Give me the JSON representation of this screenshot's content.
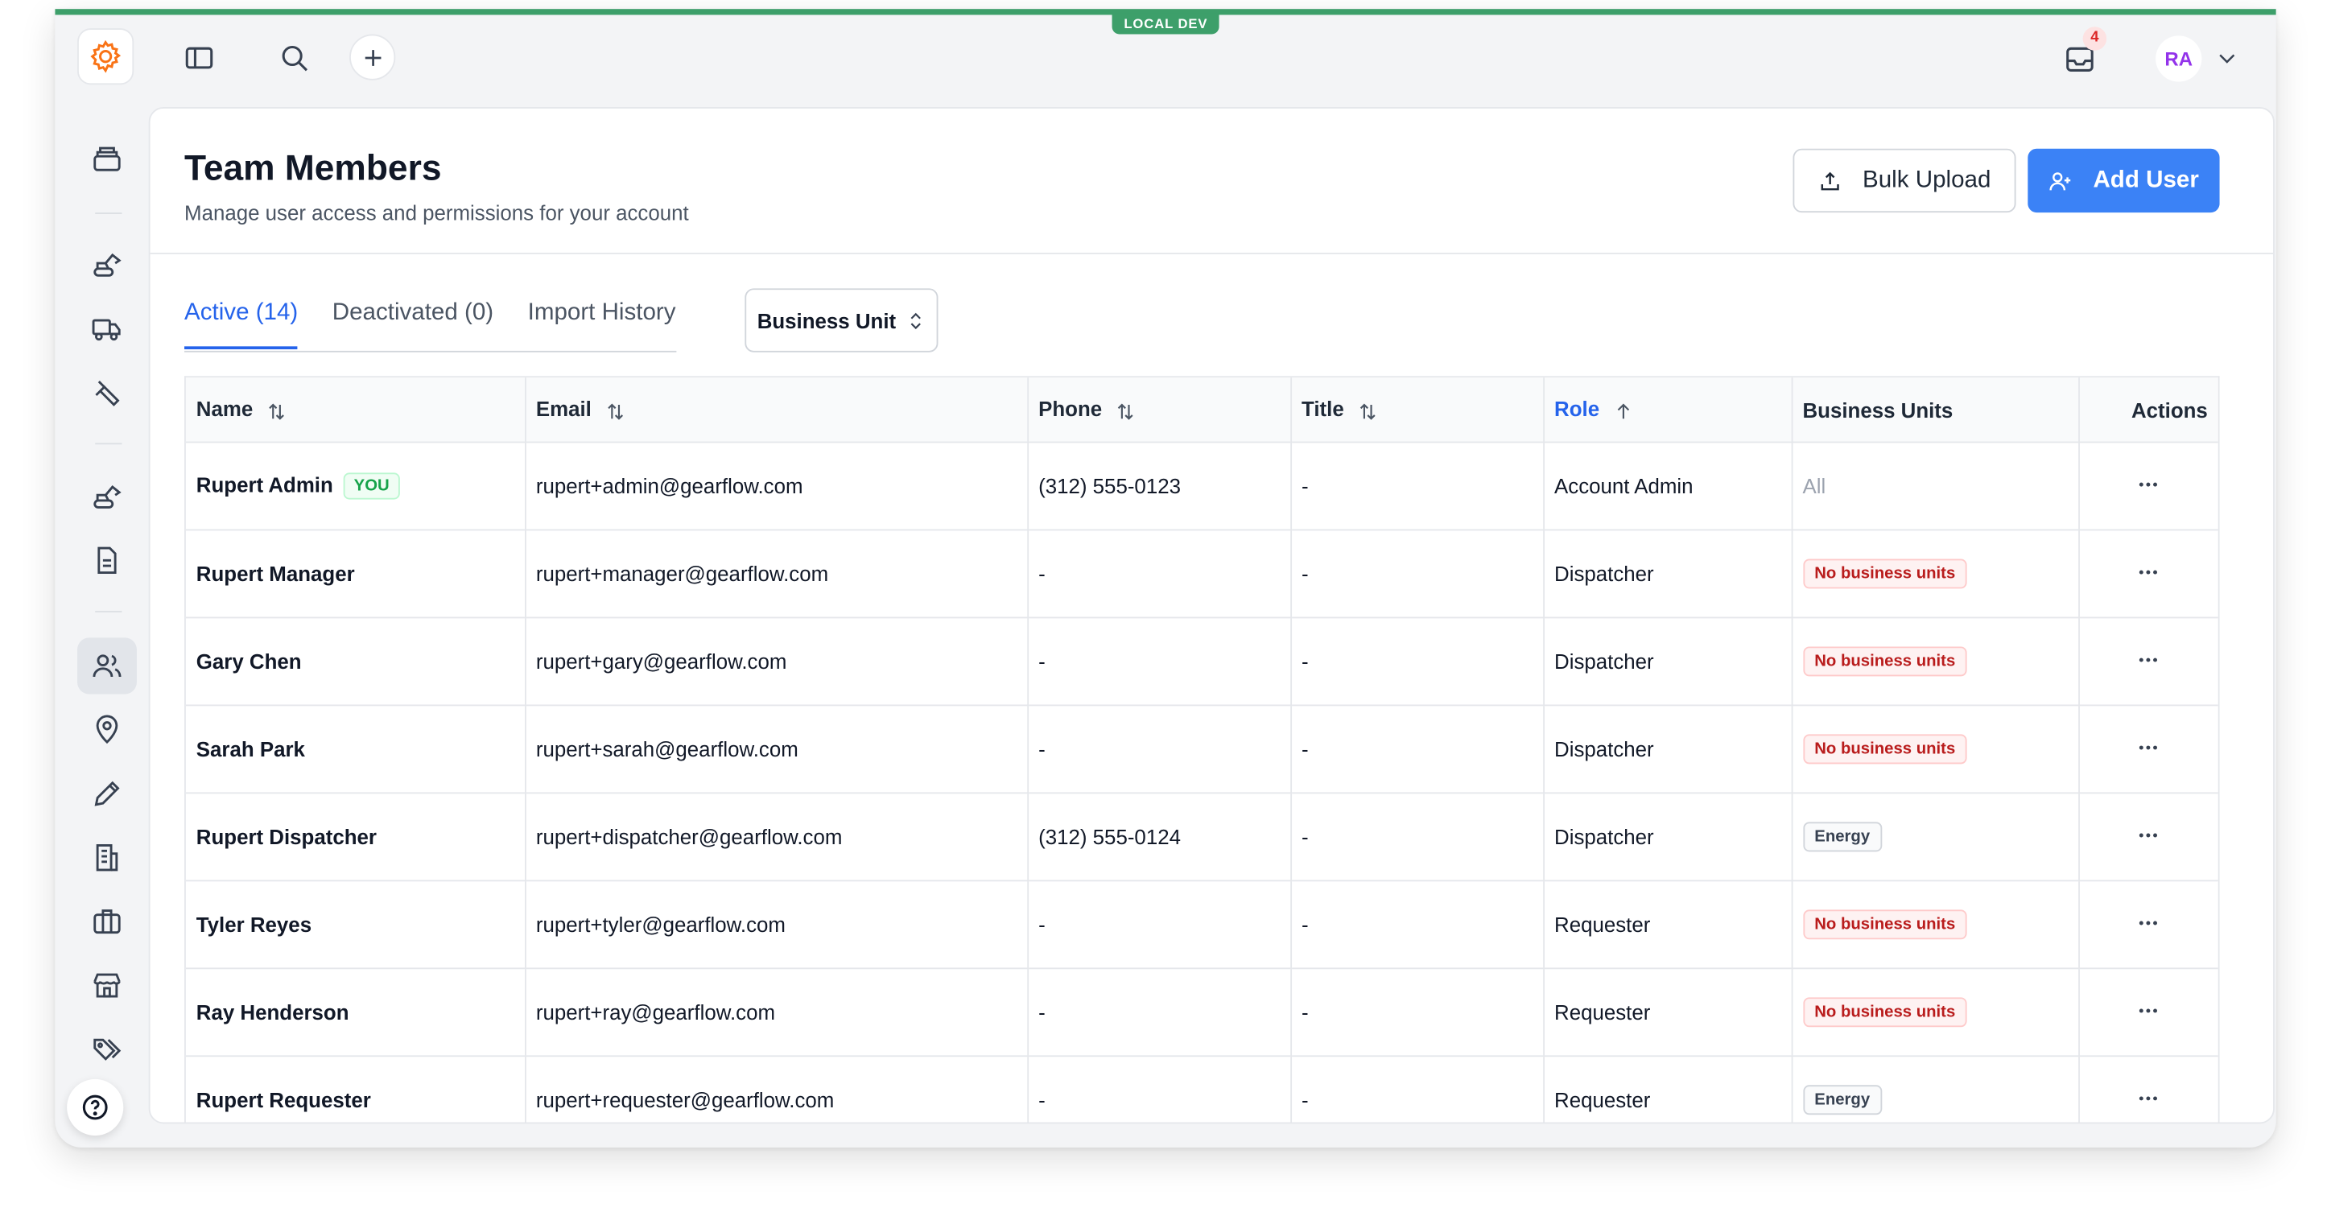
{
  "env_badge": "LOCAL DEV",
  "topbar": {
    "inbox_count": "4",
    "avatar_initials": "RA"
  },
  "header": {
    "title": "Team Members",
    "subtitle": "Manage user access and permissions for your account",
    "bulk_upload_label": "Bulk Upload",
    "add_user_label": "Add User"
  },
  "tabs": [
    {
      "label": "Active (14)",
      "active": true
    },
    {
      "label": "Deactivated (0)",
      "active": false
    },
    {
      "label": "Import History",
      "active": false
    }
  ],
  "filter": {
    "business_unit_label": "Business Unit"
  },
  "table": {
    "columns": [
      "Name",
      "Email",
      "Phone",
      "Title",
      "Role",
      "Business Units",
      "Actions"
    ],
    "sorted_column": "Role",
    "rows": [
      {
        "name": "Rupert Admin",
        "badge": "YOU",
        "email": "rupert+admin@gearflow.com",
        "phone": "(312) 555-0123",
        "title": "-",
        "role": "Account Admin",
        "bu": "All",
        "bu_kind": "all"
      },
      {
        "name": "Rupert Manager",
        "badge": "",
        "email": "rupert+manager@gearflow.com",
        "phone": "-",
        "title": "-",
        "role": "Dispatcher",
        "bu": "No business units",
        "bu_kind": "none"
      },
      {
        "name": "Gary Chen",
        "badge": "",
        "email": "rupert+gary@gearflow.com",
        "phone": "-",
        "title": "-",
        "role": "Dispatcher",
        "bu": "No business units",
        "bu_kind": "none"
      },
      {
        "name": "Sarah Park",
        "badge": "",
        "email": "rupert+sarah@gearflow.com",
        "phone": "-",
        "title": "-",
        "role": "Dispatcher",
        "bu": "No business units",
        "bu_kind": "none"
      },
      {
        "name": "Rupert Dispatcher",
        "badge": "",
        "email": "rupert+dispatcher@gearflow.com",
        "phone": "(312) 555-0124",
        "title": "-",
        "role": "Dispatcher",
        "bu": "Energy",
        "bu_kind": "tag"
      },
      {
        "name": "Tyler Reyes",
        "badge": "",
        "email": "rupert+tyler@gearflow.com",
        "phone": "-",
        "title": "-",
        "role": "Requester",
        "bu": "No business units",
        "bu_kind": "none"
      },
      {
        "name": "Ray Henderson",
        "badge": "",
        "email": "rupert+ray@gearflow.com",
        "phone": "-",
        "title": "-",
        "role": "Requester",
        "bu": "No business units",
        "bu_kind": "none"
      },
      {
        "name": "Rupert Requester",
        "badge": "",
        "email": "rupert+requester@gearflow.com",
        "phone": "-",
        "title": "-",
        "role": "Requester",
        "bu": "Energy",
        "bu_kind": "tag"
      }
    ]
  },
  "colors": {
    "accent": "#3b82f6",
    "env": "#3d9f6a",
    "logo": "#f97316"
  }
}
